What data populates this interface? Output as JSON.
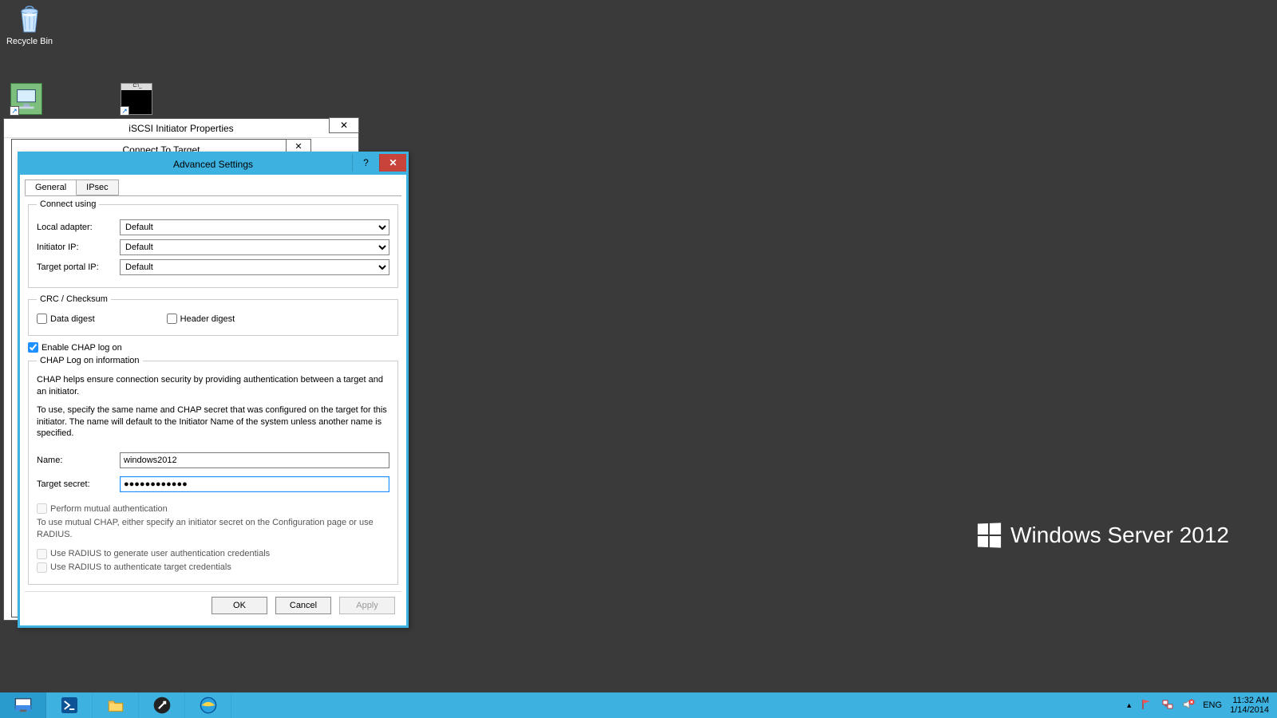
{
  "desktop": {
    "recycle_bin": "Recycle Bin"
  },
  "watermark": "Windows Server 2012",
  "bgwin1_title": "iSCSI Initiator Properties",
  "bgwin2_title": "Connect To Target",
  "dialog": {
    "title": "Advanced Settings",
    "tabs": {
      "general": "General",
      "ipsec": "IPsec"
    },
    "connect_using": {
      "legend": "Connect using",
      "local_adapter_label": "Local adapter:",
      "local_adapter_value": "Default",
      "initiator_ip_label": "Initiator IP:",
      "initiator_ip_value": "Default",
      "target_portal_ip_label": "Target portal IP:",
      "target_portal_ip_value": "Default"
    },
    "crc": {
      "legend": "CRC / Checksum",
      "data_digest": "Data digest",
      "header_digest": "Header digest"
    },
    "enable_chap": "Enable CHAP log on",
    "chap": {
      "legend": "CHAP Log on information",
      "info1": "CHAP helps ensure connection security by providing authentication between a target and an initiator.",
      "info2": "To use, specify the same name and CHAP secret that was configured on the target for this initiator.  The name will default to the Initiator Name of the system unless another name is specified.",
      "name_label": "Name:",
      "name_value": "windows2012",
      "secret_label": "Target secret:",
      "secret_value": "●●●●●●●●●●●●",
      "mutual_label": "Perform mutual authentication",
      "mutual_info": "To use mutual CHAP, either specify an initiator secret on the Configuration page or use RADIUS.",
      "radius_gen": "Use RADIUS to generate user authentication credentials",
      "radius_auth": "Use RADIUS to authenticate target credentials"
    },
    "buttons": {
      "ok": "OK",
      "cancel": "Cancel",
      "apply": "Apply"
    }
  },
  "taskbar": {
    "tray": {
      "lang": "ENG",
      "time": "11:32 AM",
      "date": "1/14/2014"
    }
  }
}
